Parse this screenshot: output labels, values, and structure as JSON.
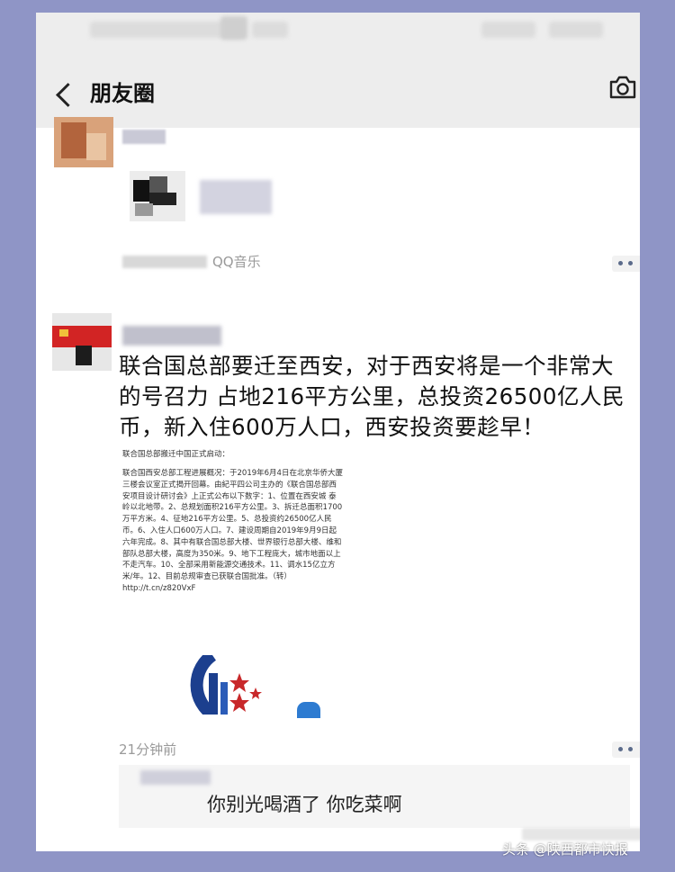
{
  "nav": {
    "title": "朋友圈"
  },
  "post1": {
    "source": "QQ音乐"
  },
  "post2": {
    "text": "联合国总部要迁至西安，对于西安将是一个非常大的号召力 占地216平方公里，总投资26500亿人民币，新入住600万人口，西安投资要趁早！",
    "image": {
      "title": "联合国总部搬迁中国正式启动：",
      "body": "联合国西安总部工程进展概况：于2019年6月4日在北京华侨大厦三楼会议室正式揭开回幕。由紀平四公司主办的《联合国总部西安项目设计研讨会》上正式公布以下数字：1、位置在西安城 泰岭以北地带。2、总规划面积216平方公里。3、拆迁总面积1700万平方米。4、征地216平方公里。5、总投资约26500亿人民币。6、入住人口600万人口。7、建设周期自2019年9月9日起六年完成。8、其中有联合国总部大楼、世界银行总部大楼、维和部队总部大楼，高度为350米。9、地下工程庞大，城市地面以上不走汽车。10、全部采用新能源交通技术。11、调水15亿立方米/年。12、目前总规审查已获联合国批准。（转）http://t.cn/z820VxF"
    },
    "time": "21分钟前"
  },
  "comment": {
    "text": "你别光喝酒了  你吃菜啊"
  },
  "watermark": "头条 @陕西都市快报"
}
